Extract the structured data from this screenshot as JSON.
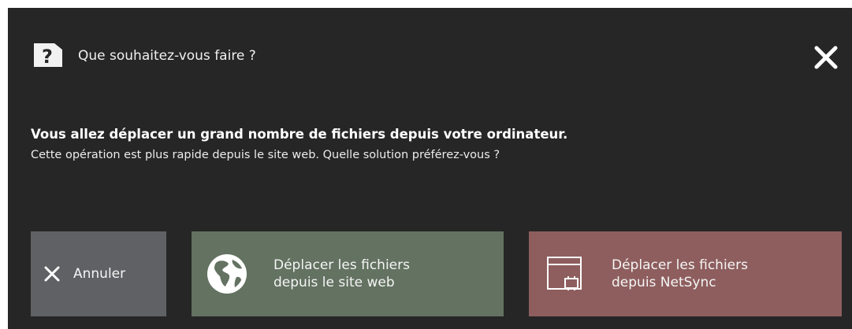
{
  "dialog": {
    "title": "Que souhaitez-vous faire ?",
    "message_bold": "Vous allez déplacer un grand nombre de fichiers depuis votre ordinateur.",
    "message_detail": "Cette opération est plus rapide depuis le site web. Quelle solution préférez-vous ?"
  },
  "buttons": {
    "cancel": {
      "label": "Annuler",
      "icon": "close-icon",
      "color": "#5f6164"
    },
    "web": {
      "line1": "Déplacer les fichiers",
      "line2": "depuis le site web",
      "icon": "globe-icon",
      "color": "#637261"
    },
    "netsync": {
      "line1": "Déplacer les fichiers",
      "line2": "depuis NetSync",
      "icon": "app-window-icon",
      "color": "#8e5e5e"
    }
  },
  "colors": {
    "background": "#262626",
    "text": "#f2f2f2"
  }
}
